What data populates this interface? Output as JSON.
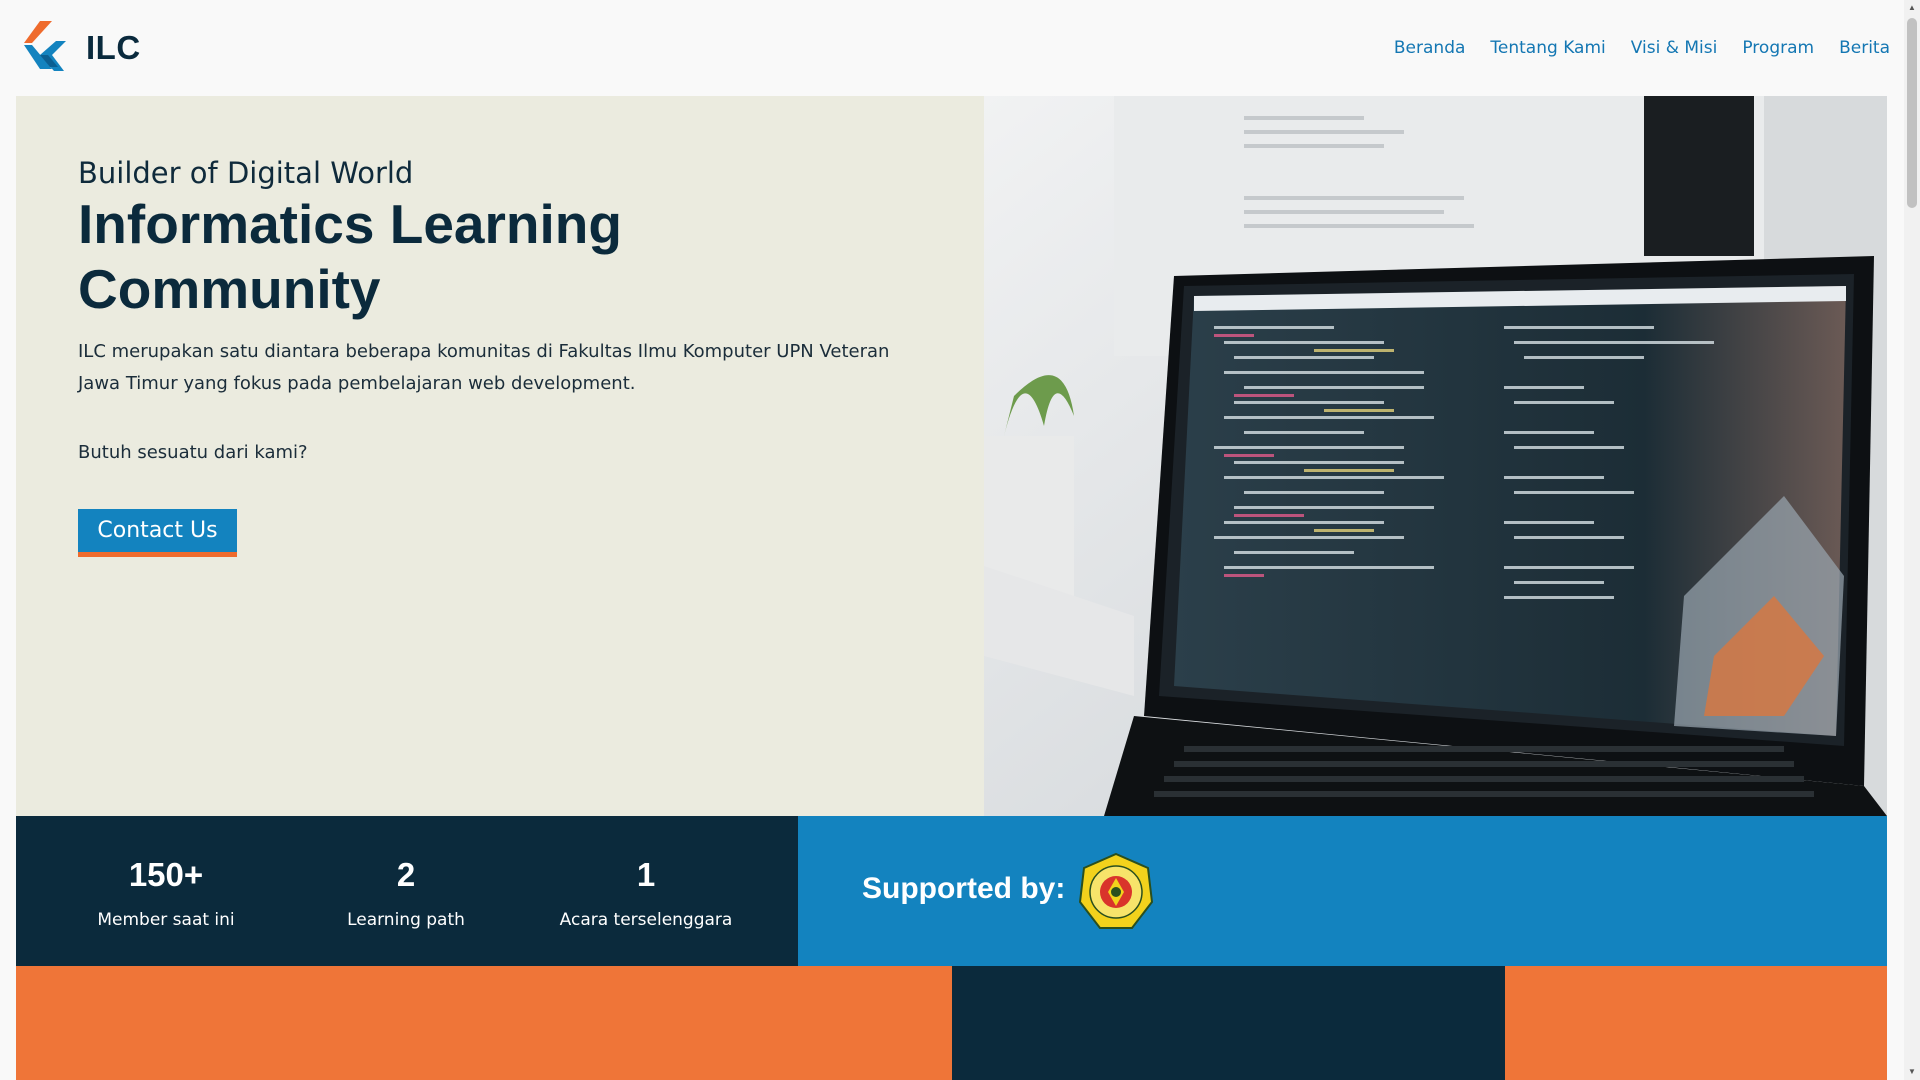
{
  "brand": {
    "name": "ILC",
    "logo_icon": "ilc-logo-icon"
  },
  "nav": {
    "items": [
      {
        "label": "Beranda"
      },
      {
        "label": "Tentang Kami"
      },
      {
        "label": "Visi & Misi"
      },
      {
        "label": "Program"
      },
      {
        "label": "Berita"
      }
    ]
  },
  "hero": {
    "tagline": "Builder of Digital World",
    "headline": "Informatics Learning Community",
    "description": "ILC merupakan satu diantara beberapa komunitas di Fakultas Ilmu Komputer UPN Veteran Jawa Timur yang fokus pada pembelajaran web development.",
    "question": "Butuh sesuatu dari kami?",
    "cta_label": "Contact Us",
    "image": "laptop-code-photo"
  },
  "stats": [
    {
      "value": "150+",
      "label": "Member saat ini"
    },
    {
      "value": "2",
      "label": "Learning path"
    },
    {
      "value": "1",
      "label": "Acara terselenggara"
    }
  ],
  "support": {
    "label": "Supported by:",
    "logo_icon": "university-seal-icon"
  },
  "colors": {
    "primary_blue": "#1383bf",
    "navy": "#0b2a3c",
    "orange": "#ef7538",
    "hero_bg": "#ebebdf"
  }
}
